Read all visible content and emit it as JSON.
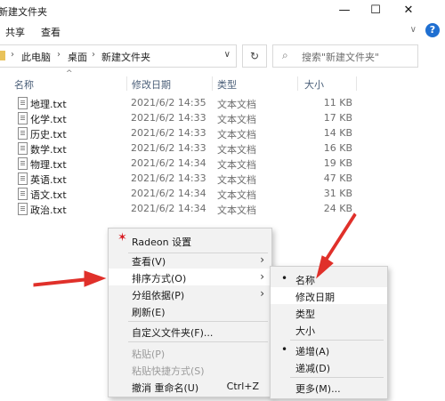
{
  "window": {
    "title": "新建文件夹",
    "minimize": "—",
    "maximize": "☐",
    "close": "✕"
  },
  "ribbon": {
    "tabs": [
      "共享",
      "查看"
    ],
    "collapse": "∨",
    "help": "?"
  },
  "address": {
    "crumbs": [
      "此电脑",
      "桌面",
      "新建文件夹"
    ],
    "separator": "›",
    "dropdown": "∨",
    "refresh": "↻",
    "search_placeholder": "搜索\"新建文件夹\""
  },
  "columns": {
    "name": "名称",
    "date": "修改日期",
    "type": "类型",
    "size": "大小",
    "sort_indicator": "^"
  },
  "files": [
    {
      "name": "地理.txt",
      "date": "2021/6/2 14:35",
      "type": "文本文档",
      "size": "11 KB"
    },
    {
      "name": "化学.txt",
      "date": "2021/6/2 14:33",
      "type": "文本文档",
      "size": "17 KB"
    },
    {
      "name": "历史.txt",
      "date": "2021/6/2 14:33",
      "type": "文本文档",
      "size": "14 KB"
    },
    {
      "name": "数学.txt",
      "date": "2021/6/2 14:33",
      "type": "文本文档",
      "size": "16 KB"
    },
    {
      "name": "物理.txt",
      "date": "2021/6/2 14:34",
      "type": "文本文档",
      "size": "19 KB"
    },
    {
      "name": "英语.txt",
      "date": "2021/6/2 14:33",
      "type": "文本文档",
      "size": "47 KB"
    },
    {
      "name": "语文.txt",
      "date": "2021/6/2 14:34",
      "type": "文本文档",
      "size": "31 KB"
    },
    {
      "name": "政治.txt",
      "date": "2021/6/2 14:34",
      "type": "文本文档",
      "size": "24 KB"
    }
  ],
  "context_menu": {
    "radeon": "Radeon 设置",
    "view": "查看(V)",
    "sort": "排序方式(O)",
    "group": "分组依据(P)",
    "refresh": "刷新(E)",
    "customize": "自定义文件夹(F)...",
    "paste": "粘贴(P)",
    "paste_shortcut": "粘贴快捷方式(S)",
    "undo": "撤消 重命名(U)",
    "undo_shortcut": "Ctrl+Z",
    "submenu_arrow": "›"
  },
  "sort_submenu": {
    "name": "名称",
    "date": "修改日期",
    "type": "类型",
    "size": "大小",
    "asc": "递增(A)",
    "desc": "递减(D)",
    "more": "更多(M)...",
    "bullet": "•"
  },
  "colors": {
    "arrow": "#e0302a",
    "help": "#1f6fd1",
    "radeon": "#d71920"
  }
}
